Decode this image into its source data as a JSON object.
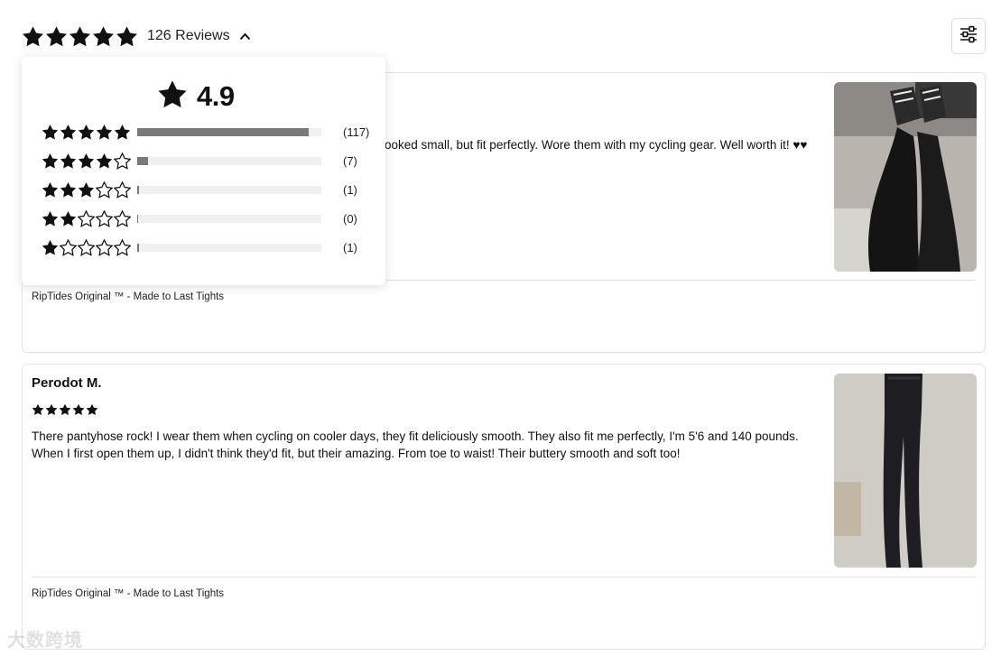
{
  "summary": {
    "rating_stars": 5,
    "review_count_label": "126 Reviews",
    "chevron_icon": "chevron-up-icon",
    "filter_icon": "sliders-icon"
  },
  "breakdown": {
    "average": "4.9",
    "rows": [
      {
        "stars": 5,
        "count_label": "(117)",
        "fraction": 0.93
      },
      {
        "stars": 4,
        "count_label": "(7)",
        "fraction": 0.06
      },
      {
        "stars": 3,
        "count_label": "(1)",
        "fraction": 0.01
      },
      {
        "stars": 2,
        "count_label": "(0)",
        "fraction": 0.0
      },
      {
        "stars": 1,
        "count_label": "(1)",
        "fraction": 0.01
      }
    ]
  },
  "reviews": [
    {
      "reviewer": "",
      "rating": 5,
      "text": "looked small, but fit perfectly. Wore them with my cycling gear. Well worth it! ♥♥",
      "product": "RipTides Original ™ - Made to Last Tights",
      "photo_desc": "legs in black tights with sneakers"
    },
    {
      "reviewer": "Perodot M.",
      "rating": 5,
      "text": "There pantyhose rock! I wear them when cycling on cooler days, they fit deliciously smooth. They also fit me perfectly, I'm 5'6 and 140 pounds. When I first open them up, I didn't think they'd fit, but their amazing. From toe to waist! Their buttery smooth and soft too!",
      "product": "RipTides Original ™ - Made to Last Tights",
      "photo_desc": "black tights laid flat"
    }
  ],
  "watermark": "大数跨境",
  "colors": {
    "star": "#111111",
    "bar_fill": "#7a7a7a",
    "bar_track": "#f0f0f0"
  }
}
